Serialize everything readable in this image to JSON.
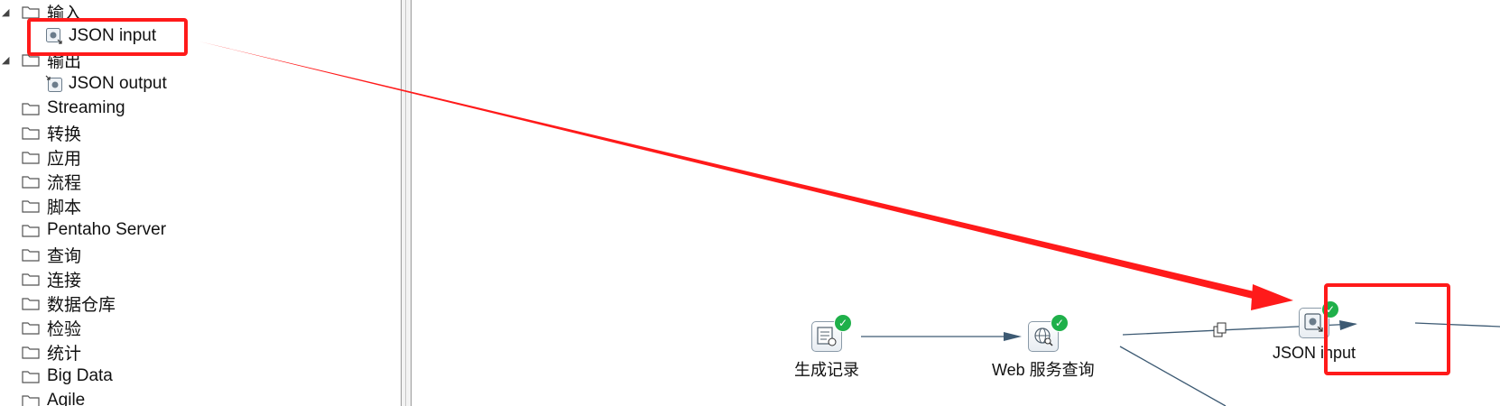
{
  "tree": {
    "items": [
      {
        "label": "输入",
        "type": "folder",
        "expanded": true
      },
      {
        "label": "JSON input",
        "type": "step"
      },
      {
        "label": "输出",
        "type": "folder",
        "expanded": true
      },
      {
        "label": "JSON output",
        "type": "step"
      },
      {
        "label": "Streaming",
        "type": "folder"
      },
      {
        "label": "转换",
        "type": "folder"
      },
      {
        "label": "应用",
        "type": "folder"
      },
      {
        "label": "流程",
        "type": "folder"
      },
      {
        "label": "脚本",
        "type": "folder"
      },
      {
        "label": "Pentaho Server",
        "type": "folder"
      },
      {
        "label": "查询",
        "type": "folder"
      },
      {
        "label": "连接",
        "type": "folder"
      },
      {
        "label": "数据仓库",
        "type": "folder"
      },
      {
        "label": "检验",
        "type": "folder"
      },
      {
        "label": "统计",
        "type": "folder"
      },
      {
        "label": "Big Data",
        "type": "folder"
      },
      {
        "label": "Agile",
        "type": "folder"
      }
    ]
  },
  "canvas": {
    "steps": [
      {
        "label": "生成记录",
        "icon": "generate-rows-icon",
        "status": "ok"
      },
      {
        "label": "Web 服务查询",
        "icon": "web-service-icon",
        "status": "ok"
      },
      {
        "label": "JSON input",
        "icon": "json-input-icon",
        "status": "ok"
      }
    ],
    "hop_icon": "copy-rows-icon"
  },
  "colors": {
    "annotation": "#ff1a1a",
    "hop_line": "#3d5a73",
    "ok_badge": "#1fb04a"
  }
}
